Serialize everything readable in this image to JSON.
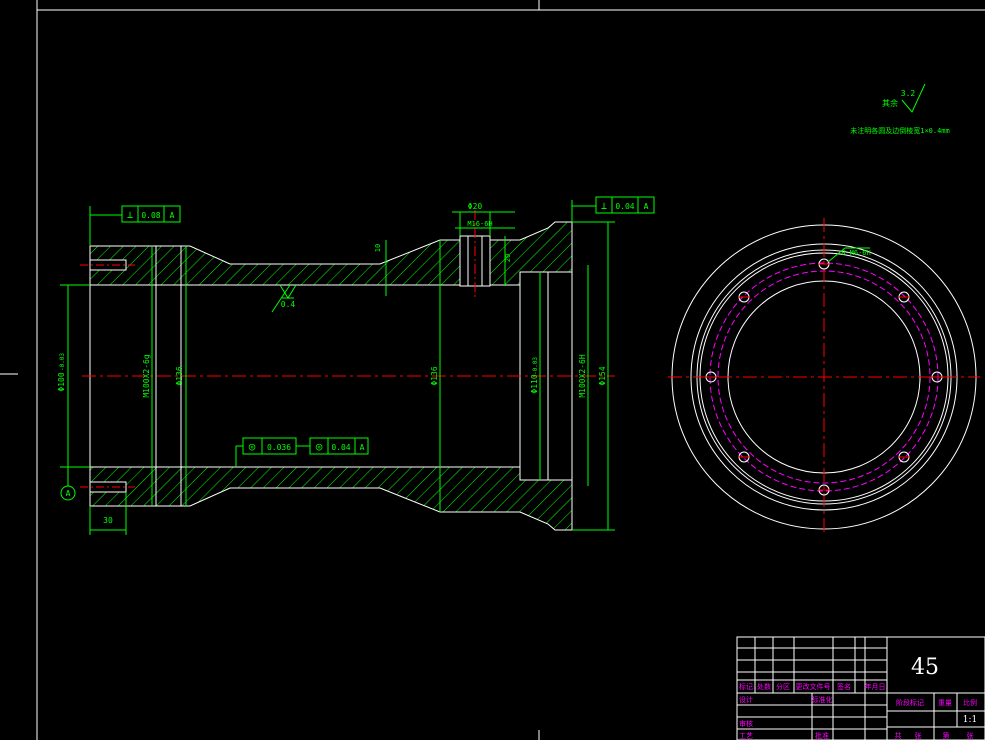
{
  "roughness": {
    "prefix": "其余",
    "value": "3.2",
    "note": "未注明各圆及边倒棱宽1×0.4mm"
  },
  "datum": {
    "label": "A"
  },
  "frames": {
    "top_left": {
      "symbol": "⊥",
      "tol": "0.08",
      "ref": "A"
    },
    "top_right": {
      "symbol": "⊥",
      "tol": "0.04",
      "ref": "A"
    },
    "mid_1": {
      "symbol": "◎",
      "tol": "0.036"
    },
    "mid_2": {
      "symbol": "◎",
      "tol": "0.04",
      "ref": "A"
    }
  },
  "dims": {
    "d_left_bore": "Φ100",
    "d_left_bore_tol": "-0.03",
    "thread_left": "M100X2-6g",
    "d_136": "Φ136",
    "d_center": "Φ136",
    "d_110": "Φ110",
    "d_110_tol": "-0.03",
    "thread_right": "M100X2-6H",
    "d_154": "Φ154",
    "d_20": "Φ20",
    "thread_hole": "M16-6H",
    "depth_10": "10",
    "depth_20": "20",
    "len_30": "30",
    "roughness_bore": "0.4"
  },
  "end_view": {
    "hole_callout": "8-M6-6H"
  },
  "title_block": {
    "part_material": "45",
    "scale": "1:1",
    "row_headers": [
      "标记",
      "处数",
      "分区",
      "更改文件号",
      "签名",
      "年月日"
    ],
    "left_labels": [
      "设计",
      "标准化",
      "审核",
      "工艺",
      "批准"
    ],
    "right_headers": [
      "阶段标记",
      "重量",
      "比例"
    ],
    "bottom_labels": [
      "共",
      "张",
      "第",
      "张"
    ]
  },
  "colors": {
    "outline": "#ffffff",
    "dimension": "#00ff00",
    "hatch": "#00ff00",
    "centerline": "#ff0000",
    "hidden": "#ff00ff",
    "bg": "#000000"
  }
}
